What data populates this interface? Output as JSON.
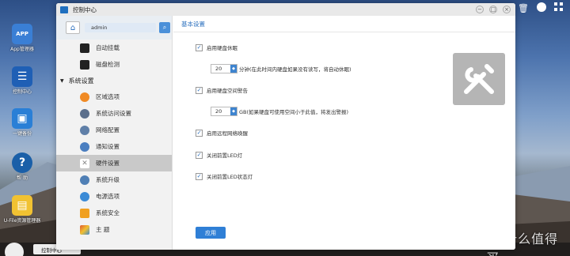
{
  "desktop": {
    "items": [
      {
        "label": "App管理器",
        "icon": "app-store-icon",
        "color": "#3a7fd5",
        "glyph": "APP"
      },
      {
        "label": "控制中心",
        "icon": "control-center-icon",
        "color": "#1f5fb5",
        "glyph": "☰"
      },
      {
        "label": "一键备份",
        "icon": "backup-icon",
        "color": "#2a7fd6",
        "glyph": "▣"
      },
      {
        "label": "帮 助",
        "icon": "help-icon",
        "color": "#1a5fa8",
        "glyph": "?"
      },
      {
        "label": "U-File资源管理器",
        "icon": "file-manager-icon",
        "color": "#f1c232",
        "glyph": "▤"
      }
    ]
  },
  "system_tray": {
    "icons": [
      "trash-icon",
      "user-icon",
      "apps-grid-icon"
    ]
  },
  "taskbar": {
    "task_label": "控制中心"
  },
  "watermark": "值 什么值得买",
  "window": {
    "title": "控制中心",
    "controls": {
      "minimize": "−",
      "maximize": "□",
      "close": "×"
    }
  },
  "sidebar": {
    "user": "admin",
    "items": [
      {
        "label": "自动挂载",
        "icon": "auto-mount-icon",
        "color": "#222"
      },
      {
        "label": "磁盘检测",
        "icon": "disk-check-icon",
        "color": "#222"
      }
    ],
    "group_label": "系统设置",
    "group_items": [
      {
        "label": "区域选项",
        "icon": "region-icon",
        "color": "#f08a24"
      },
      {
        "label": "系统访问设置",
        "icon": "access-icon",
        "color": "#5b6f8c"
      },
      {
        "label": "网络配置",
        "icon": "network-icon",
        "color": "#5f7fa8"
      },
      {
        "label": "通知设置",
        "icon": "notification-icon",
        "color": "#4a7ec0"
      },
      {
        "label": "硬件设置",
        "icon": "hardware-icon",
        "color": "#aaa",
        "active": true
      },
      {
        "label": "系统升级",
        "icon": "upgrade-icon",
        "color": "#4f7fb5"
      },
      {
        "label": "电源选项",
        "icon": "power-icon",
        "color": "#3b8ad6"
      },
      {
        "label": "系统安全",
        "icon": "security-icon",
        "color": "#f0a020"
      },
      {
        "label": "主 题",
        "icon": "theme-icon",
        "color": "#e05a30"
      }
    ]
  },
  "content": {
    "header": "基本设置",
    "options": [
      {
        "label": "启用硬盘休眠",
        "checked": true
      },
      {
        "label": "启用硬盘空间警告",
        "checked": true
      },
      {
        "label": "启用远程网络唤醒",
        "checked": true
      },
      {
        "label": "关闭前置LED灯",
        "checked": true
      },
      {
        "label": "关闭前置LED状态灯",
        "checked": true
      }
    ],
    "sleep_value": "20",
    "sleep_suffix": "分钟(在此时间内硬盘如果没有读写，将自动休眠)",
    "space_value": "20",
    "space_suffix": "GB(如果硬盘可使用空间小于此值，将发出警报)",
    "check_glyph": "✓",
    "spin_glyph": "◆",
    "apply_label": "应用"
  }
}
